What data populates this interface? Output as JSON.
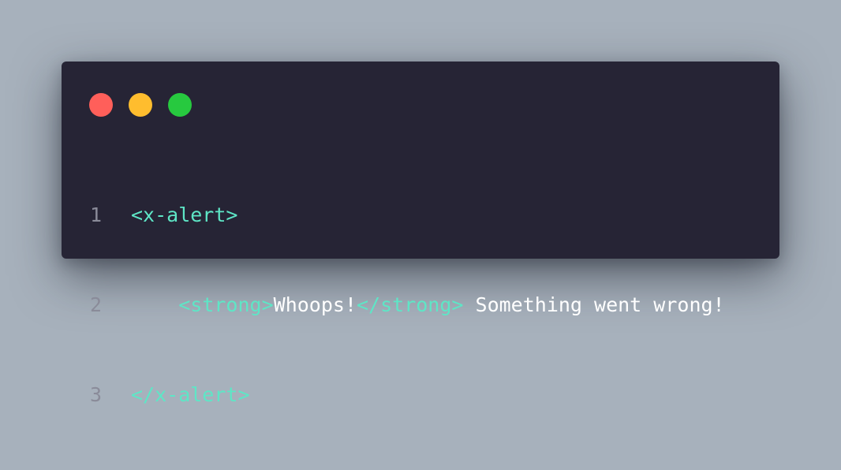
{
  "colors": {
    "background": "#a7b1bc",
    "window": "#262435",
    "close": "#ff5f5a",
    "minimize": "#ffbd2e",
    "maximize": "#27c93f",
    "tag": "#5ee6c6",
    "text": "#ffffff",
    "line_number": "#8a8b99"
  },
  "code": {
    "lines": [
      {
        "number": "1",
        "indent": "",
        "tokens": [
          {
            "type": "tag",
            "text": "<x-alert>"
          }
        ]
      },
      {
        "number": "2",
        "indent": "    ",
        "tokens": [
          {
            "type": "tag",
            "text": "<strong>"
          },
          {
            "type": "text",
            "text": "Whoops!"
          },
          {
            "type": "tag",
            "text": "</strong>"
          },
          {
            "type": "text",
            "text": " Something went wrong!"
          }
        ]
      },
      {
        "number": "3",
        "indent": "",
        "tokens": [
          {
            "type": "tag",
            "text": "</x-alert>"
          }
        ]
      }
    ]
  }
}
